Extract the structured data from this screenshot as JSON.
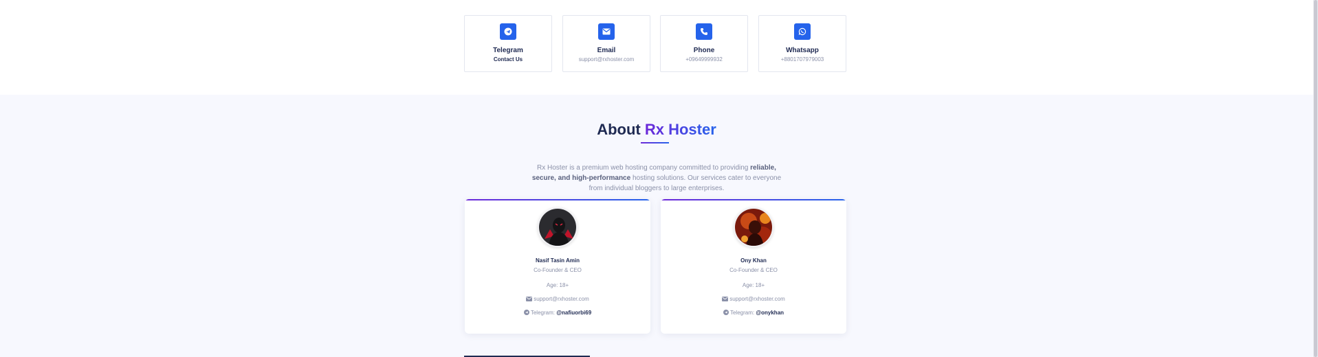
{
  "contacts": [
    {
      "title": "Telegram",
      "value": "Contact Us",
      "icon": "telegram-icon"
    },
    {
      "title": "Email",
      "value": "support@rxhoster.com",
      "icon": "envelope-icon"
    },
    {
      "title": "Phone",
      "value": "+09649999932",
      "icon": "phone-icon"
    },
    {
      "title": "Whatsapp",
      "value": "+8801707979003",
      "icon": "whatsapp-icon"
    }
  ],
  "about": {
    "title_prefix": "About",
    "title_accent": "Rx Hoster",
    "desc_1": "Rx Hoster is a premium web hosting company committed to providing ",
    "desc_bold": "reliable, secure, and high-performance",
    "desc_2": " hosting solutions. Our services cater to everyone from individual bloggers to large enterprises."
  },
  "team": [
    {
      "name": "Nasif Tasin Amin",
      "role": "Co-Founder & CEO",
      "age": "Age: 18+",
      "email": "support@rxhoster.com",
      "telegram_label": "Telegram:",
      "telegram_handle": "@nafiuorbi69"
    },
    {
      "name": "Ony Khan",
      "role": "Co-Founder & CEO",
      "age": "Age: 18+",
      "email": "support@rxhoster.com",
      "telegram_label": "Telegram:",
      "telegram_handle": "@onykhan"
    }
  ],
  "colors": {
    "accent_blue": "#2563eb",
    "accent_purple": "#6d28d9",
    "navy": "#1f2a52",
    "muted": "#8a90a8"
  }
}
